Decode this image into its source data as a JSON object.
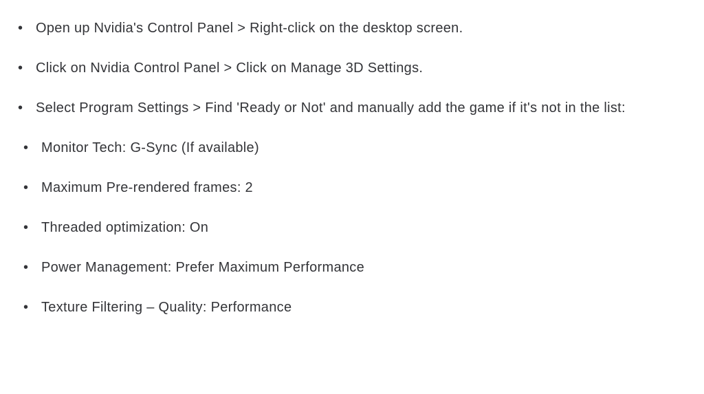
{
  "steps": {
    "primary": [
      "Open up Nvidia's Control Panel > Right-click on the desktop screen.",
      "Click on Nvidia Control Panel > Click on Manage 3D Settings.",
      "Select Program Settings > Find 'Ready or Not' and manually add the game if it's not in the list:"
    ],
    "settings": [
      "Monitor Tech: G-Sync (If available)",
      "Maximum Pre-rendered frames: 2",
      "Threaded optimization: On",
      "Power Management: Prefer Maximum Performance",
      "Texture Filtering – Quality: Performance"
    ]
  }
}
